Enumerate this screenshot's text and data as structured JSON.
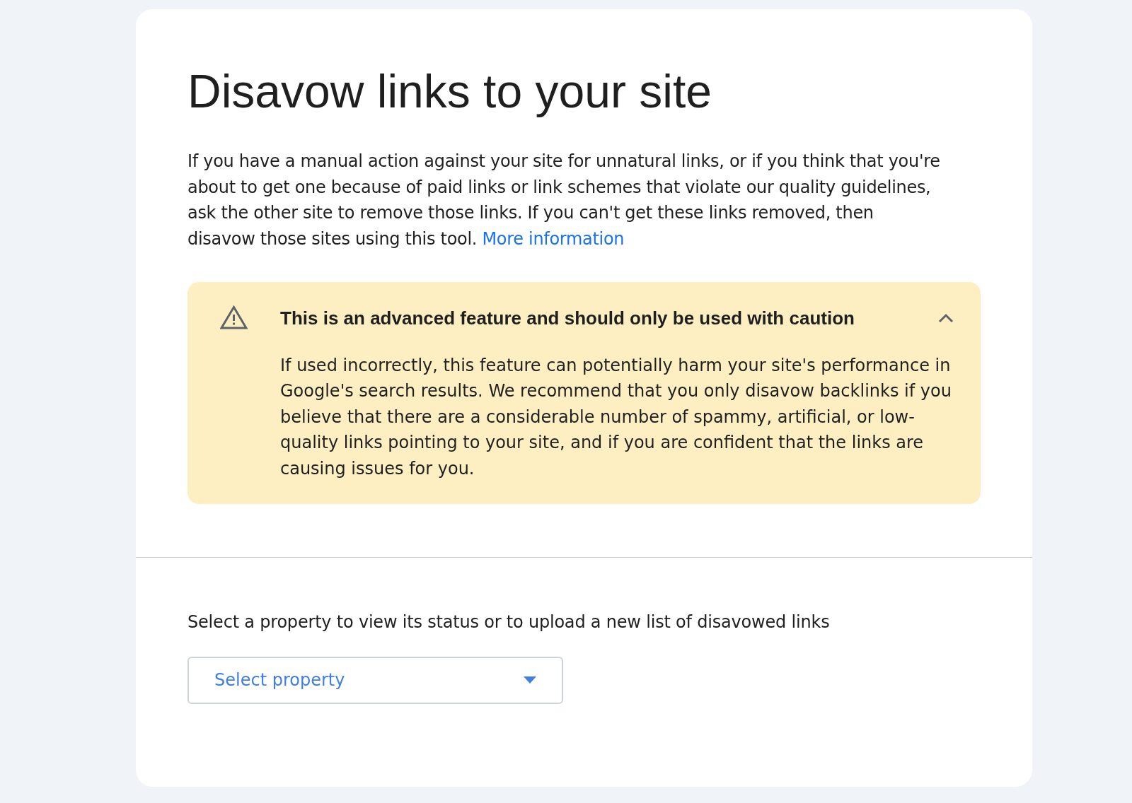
{
  "title": "Disavow links to your site",
  "intro": {
    "text": "If you have a manual action against your site for unnatural links, or if you think that you're about to get one because of paid links or link schemes that violate our quality guidelines, ask the other site to remove those links. If you can't get these links removed, then disavow those sites using this tool.",
    "link": "More information"
  },
  "warning": {
    "heading": "This is an advanced feature and should only be used with caution",
    "expanded": true,
    "body": "If used incorrectly, this feature can potentially harm your site's performance in Google's search results. We recommend that you only disavow backlinks if you believe that there are a considerable number of spammy, artificial, or low-quality links pointing to your site, and if you are confident that the links are causing issues for you."
  },
  "property_prompt": "Select a property to view its status or to upload a new list of disavowed links",
  "property_select": {
    "label": "Select property"
  }
}
